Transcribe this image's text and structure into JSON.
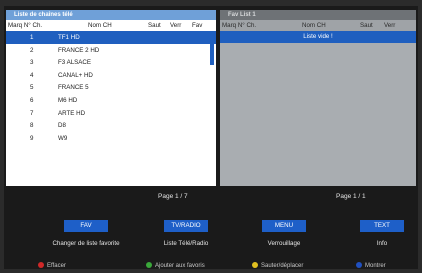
{
  "left_panel": {
    "title": "Liste de chaînes télé",
    "columns": {
      "num": "Marq N° Ch.",
      "name": "Nom CH",
      "skip": "Saut",
      "lock": "Verr",
      "fav": "Fav"
    },
    "rows": [
      {
        "num": "1",
        "name": "TF1 HD"
      },
      {
        "num": "2",
        "name": "FRANCE 2 HD"
      },
      {
        "num": "3",
        "name": "F3 ALSACE"
      },
      {
        "num": "4",
        "name": "CANAL+ HD"
      },
      {
        "num": "5",
        "name": "FRANCE 5"
      },
      {
        "num": "6",
        "name": "M6 HD"
      },
      {
        "num": "7",
        "name": "ARTE HD"
      },
      {
        "num": "8",
        "name": "D8"
      },
      {
        "num": "9",
        "name": "W9"
      }
    ],
    "page": "Page 1 / 7"
  },
  "right_panel": {
    "title": "Fav List 1",
    "columns": {
      "num": "Marq N° Ch.",
      "name": "Nom CH",
      "skip": "Saut",
      "lock": "Verr"
    },
    "empty_label": "Liste vide !",
    "page": "Page 1 / 1"
  },
  "buttons": [
    {
      "key": "FAV",
      "label": "Changer de liste favorite"
    },
    {
      "key": "TV/RADIO",
      "label": "Liste Télé/Radio"
    },
    {
      "key": "MENU",
      "label": "Verrouillage"
    },
    {
      "key": "TEXT",
      "label": "Info"
    }
  ],
  "legend": [
    {
      "label": "Effacer",
      "color": "#d02828"
    },
    {
      "label": "Ajouter aux favoris",
      "color": "#3aa83a"
    },
    {
      "label": "Sauter/déplacer",
      "color": "#e0c020"
    },
    {
      "label": "Montrer",
      "color": "#2050c0"
    }
  ],
  "colors": {
    "selection": "#1f5fbf",
    "button": "#1e5fc8",
    "title_bar": "#6fa0d8"
  }
}
